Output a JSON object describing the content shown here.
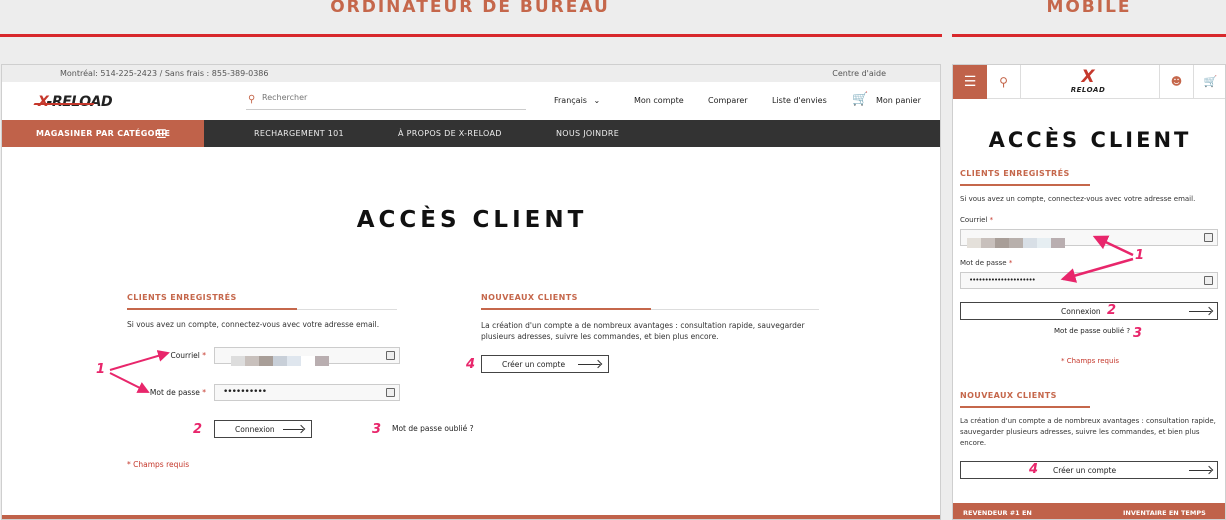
{
  "sections": {
    "desktop_heading": "ORDINATEUR DE BUREAU",
    "mobile_heading": "MOBILE"
  },
  "desktop": {
    "topbar": {
      "phone": "Montréal: 514-225-2423 / Sans frais : 855-389-0386",
      "help": "Centre d'aide"
    },
    "header": {
      "logo_x": "X",
      "logo_text": "-RELOAD",
      "search_placeholder": "Rechercher",
      "language": "Français",
      "language_chevron": "⌄",
      "account": "Mon compte",
      "compare": "Comparer",
      "wishlist": "Liste d'envies",
      "cart": "Mon panier"
    },
    "catbar": {
      "shop_by_category": "MAGASINER PAR CATÉGORIE",
      "links": [
        "RECHARGEMENT 101",
        "À PROPOS DE X-RELOAD",
        "NOUS JOINDRE"
      ]
    },
    "page_title": "ACCÈS CLIENT",
    "registered": {
      "title": "CLIENTS ENREGISTRÉS",
      "intro": "Si vous avez un compte, connectez-vous avec votre adresse email.",
      "email_label": "Courriel",
      "password_label": "Mot de passe",
      "required_mark": "*",
      "password_value": "••••••••••",
      "login_button": "Connexion",
      "forgot": "Mot de passe oublié ?",
      "required_note": "* Champs requis"
    },
    "new_clients": {
      "title": "NOUVEAUX CLIENTS",
      "text": "La création d'un compte a de nombreux avantages : consultation rapide, sauvegarder plusieurs adresses, suivre les commandes, et bien plus encore.",
      "create_button": "Créer un compte"
    },
    "annotations": [
      "1",
      "2",
      "3",
      "4"
    ]
  },
  "mobile": {
    "logo_x": "X",
    "logo_text": "RELOAD",
    "page_title": "ACCÈS CLIENT",
    "registered": {
      "title": "CLIENTS ENREGISTRÉS",
      "intro": "Si vous avez un compte, connectez-vous avec votre adresse email.",
      "email_label": "Courriel",
      "password_label": "Mot de passe",
      "required_mark": "*",
      "password_value": "•••••••••••••••••••••",
      "login_button": "Connexion",
      "forgot": "Mot de passe oublié ?",
      "required_note": "* Champs requis"
    },
    "new_clients": {
      "title": "NOUVEAUX CLIENTS",
      "text": "La création d'un compte a de nombreux avantages : consultation rapide, sauvegarder plusieurs adresses, suivre les commandes, et bien plus encore.",
      "create_button": "Créer un compte"
    },
    "footer_left": "REVENDEUR #1 EN",
    "footer_right": "INVENTAIRE EN TEMPS",
    "annotations": [
      "1",
      "2",
      "3",
      "4"
    ]
  },
  "colors": {
    "accent": "#c0624a",
    "brand_red": "#c5382c",
    "annotation": "#e8266b",
    "dark_bar": "#333333"
  },
  "icons": {
    "search": "magnifier-icon",
    "menu": "hamburger-icon",
    "cart": "cart-icon",
    "user": "user-icon",
    "key": "password-key-icon",
    "arrow": "arrow-right-icon"
  }
}
